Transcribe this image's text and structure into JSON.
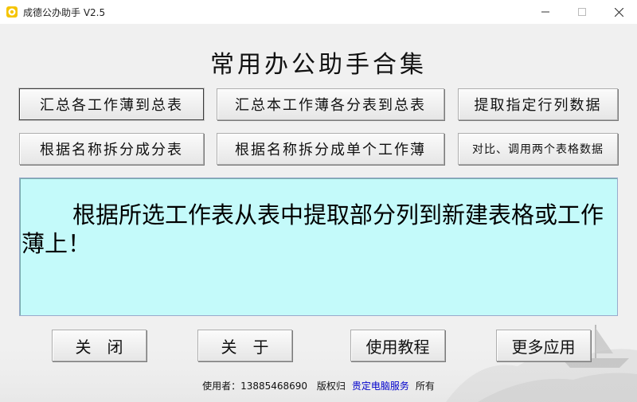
{
  "window": {
    "title": "成德公办助手 V2.5",
    "controls": {
      "minimize": "minimize-icon",
      "maximize": "maximize-icon",
      "close": "close-icon"
    }
  },
  "heading": "常用办公助手合集",
  "functions": [
    {
      "label": "汇总各工作薄到总表"
    },
    {
      "label": "汇总本工作薄各分表到总表"
    },
    {
      "label": "提取指定行列数据"
    },
    {
      "label": "根据名称拆分成分表"
    },
    {
      "label": "根据名称拆分成单个工作薄"
    },
    {
      "label": "对比、调用两个表格数据"
    }
  ],
  "description": "根据所选工作表从表中提取部分列到新建表格或工作薄上！",
  "actions": {
    "close": "关　闭",
    "about": "关　于",
    "tutorial": "使用教程",
    "more": "更多应用"
  },
  "footer": {
    "user_label": "使用者：13885468690",
    "copyright_prefix": "版权归",
    "copyright_link": "贵定电脑服务",
    "copyright_suffix": "所有"
  },
  "colors": {
    "description_bg": "#c4fafa",
    "window_bg": "#f0f0f0",
    "link": "#0000cc"
  }
}
